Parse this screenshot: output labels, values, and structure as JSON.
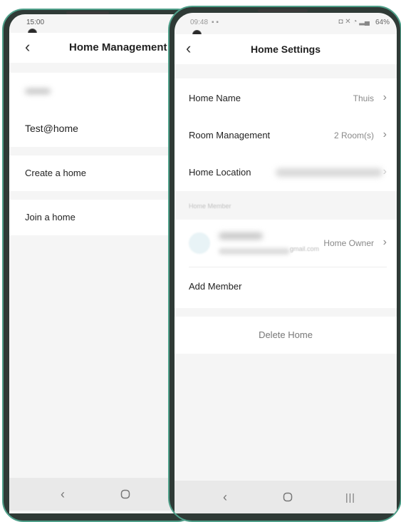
{
  "back_screen": {
    "time": "15:00",
    "title": "Home Management",
    "homes": [
      "Test@home"
    ],
    "create_label": "Create a home",
    "join_label": "Join a home"
  },
  "front_screen": {
    "time": "09:48",
    "battery": "64%",
    "title": "Home Settings",
    "rows": [
      {
        "label": "Home Name",
        "value": "Thuis"
      },
      {
        "label": "Room Management",
        "value": "2 Room(s)"
      },
      {
        "label": "Home Location",
        "value": ""
      }
    ],
    "member_header": "Home Member",
    "member_role": "Home Owner",
    "member_email_tail": "gmail.com",
    "add_member_label": "Add Member",
    "delete_label": "Delete Home"
  },
  "icons": {
    "back": "chevron-left-icon",
    "chevron": "chevron-right-icon",
    "nav_back": "nav-back-icon",
    "nav_home": "nav-home-icon",
    "nav_recents": "nav-recents-icon"
  },
  "colors": {
    "phone_frame": "#4fa08a",
    "screen_bg": "#f5f5f5",
    "card_bg": "#ffffff"
  }
}
